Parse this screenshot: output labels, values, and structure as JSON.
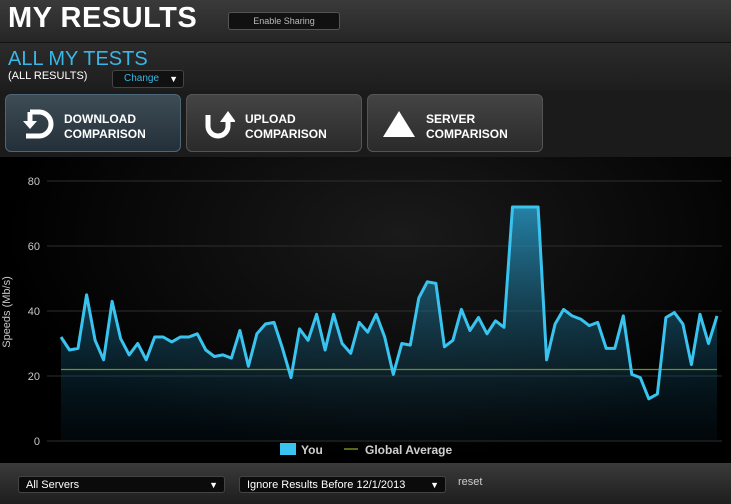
{
  "header": {
    "title": "MY RESULTS",
    "share_label": "Enable Sharing"
  },
  "subheader": {
    "title": "ALL MY TESTS",
    "caption": "(ALL RESULTS)",
    "change_label": "Change"
  },
  "tabs": [
    {
      "label": "DOWNLOAD\nCOMPARISON",
      "icon": "download-icon",
      "active": true
    },
    {
      "label": "UPLOAD\nCOMPARISON",
      "icon": "upload-icon",
      "active": false
    },
    {
      "label": "SERVER\nCOMPARISON",
      "icon": "triangle-icon",
      "active": false
    }
  ],
  "chart_data": {
    "type": "area",
    "ylabel": "Speeds (Mb/s)",
    "xlabel": "",
    "ylim": [
      0,
      80
    ],
    "yticks": [
      0,
      20,
      40,
      60,
      80
    ],
    "grid": true,
    "legend": "bottom-center",
    "series": [
      {
        "name": "You",
        "color": "#39c4f0",
        "values": [
          32,
          28,
          28.5,
          45,
          31,
          25,
          43,
          31.5,
          26.5,
          30,
          25,
          32,
          32,
          30.5,
          32,
          32,
          33,
          28,
          26,
          26.5,
          25.5,
          34,
          23,
          33,
          36,
          36.5,
          28.5,
          19.5,
          34.5,
          31,
          39,
          28,
          39,
          30,
          27,
          36.5,
          33.5,
          39,
          32,
          20.5,
          30,
          29.5,
          44,
          49,
          48.5,
          29,
          31,
          40.5,
          34,
          38,
          33,
          37,
          35,
          72,
          72,
          72,
          72,
          25,
          36,
          40.5,
          38.5,
          37.5,
          35.5,
          36.5,
          28.5,
          28.5,
          38.5,
          20.5,
          19.5,
          13,
          14.5,
          38,
          39.5,
          36,
          23.5,
          39,
          30,
          38.5
        ]
      },
      {
        "name": "Global Average",
        "color": "#6f8f1c",
        "values": [
          22
        ]
      }
    ]
  },
  "footer": {
    "servers_label": "All Servers",
    "ignore_label": "Ignore Results Before 12/1/2013",
    "reset_label": "reset"
  }
}
